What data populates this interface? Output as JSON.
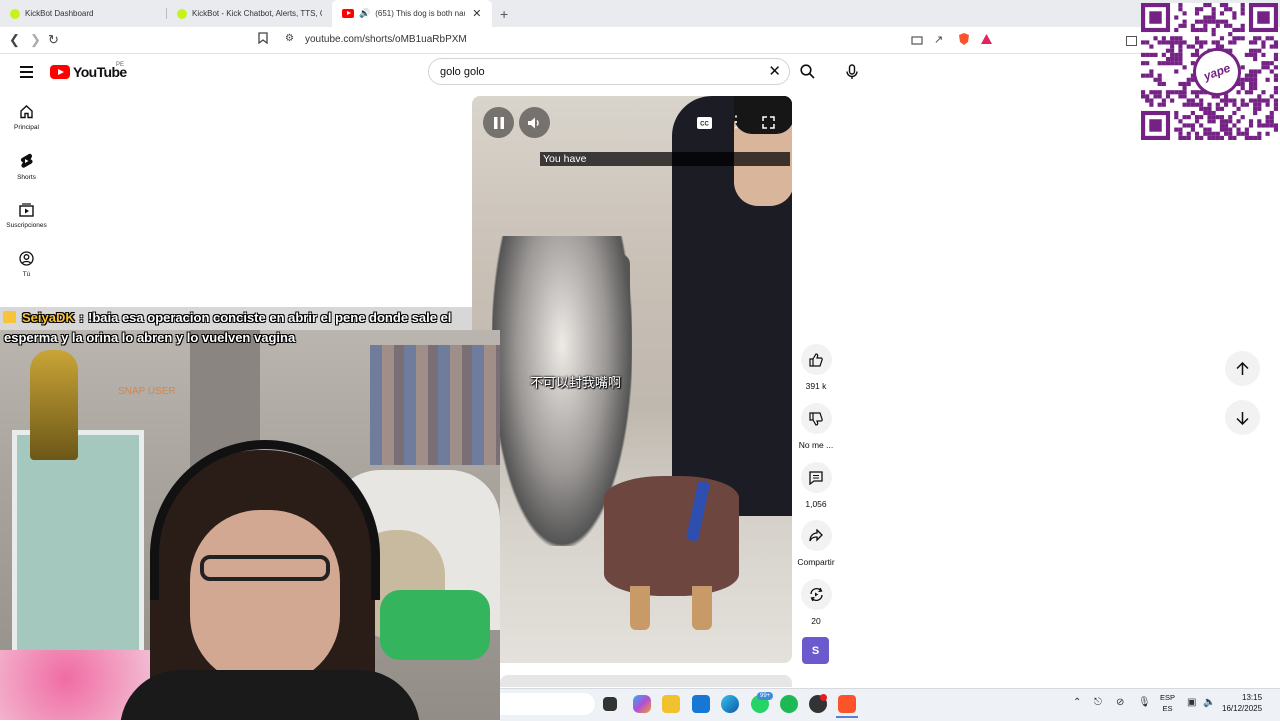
{
  "browser": {
    "tabs": [
      {
        "title": "KickBot Dashboard"
      },
      {
        "title": "KickBot - Kick Chatbot, Alerts, TTS, C"
      },
      {
        "title": "(651) This dog is both naugh",
        "active": true
      }
    ],
    "url": "youtube.com/shorts/oMB1uaRbPXM"
  },
  "youtube": {
    "logo_text": "YouTube",
    "country": "PE",
    "search": {
      "value": "golo golo"
    },
    "nav": [
      {
        "label": "Principal",
        "icon": "home-icon"
      },
      {
        "label": "Shorts",
        "icon": "shorts-icon"
      },
      {
        "label": "Suscripciones",
        "icon": "subscriptions-icon"
      },
      {
        "label": "Tú",
        "icon": "you-icon"
      }
    ],
    "video": {
      "caption": "You have",
      "chinese_subtitle": "不可以封我嘴啊"
    },
    "actions": {
      "likes": "391 k",
      "dislike_label": "No me ...",
      "comments": "1,056",
      "share_label": "Compartir",
      "remix_count": "20",
      "channel_initial": "S"
    }
  },
  "overlay": {
    "chat": {
      "user": "SeiyaDK",
      "separator": ":",
      "message_line1": "!baia esa operacion conciste en abrir el pene donde sale el",
      "message_line2": "esperma y la orina lo abren y lo vuelven vagina"
    },
    "qr_brand": "yape",
    "cam_sign": "SNAP USER"
  },
  "taskbar": {
    "whatsapp_badge": "99+",
    "language": {
      "line1": "ESP",
      "line2": "ES"
    },
    "time": "13:15",
    "date": "16/12/2025"
  },
  "colors": {
    "youtube_red": "#ff0000",
    "chat_user": "#f6c339",
    "yape_purple": "#742284"
  }
}
